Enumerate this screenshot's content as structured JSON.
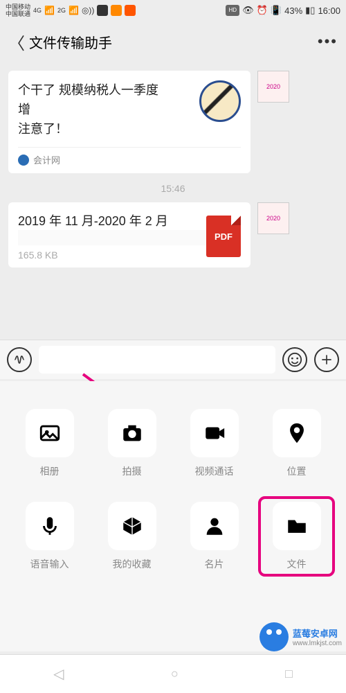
{
  "status": {
    "carrier1": "中国移动",
    "carrier2": "中国联通",
    "net1": "4G",
    "net2": "2G",
    "hd": "HD",
    "battery": "43%",
    "time": "16:00"
  },
  "header": {
    "title": "文件传输助手"
  },
  "article": {
    "line1": "个干了              规模纳税人一季度",
    "line2": "增                                        ",
    "line3": "注意了！",
    "source": "会计网",
    "avatar_badge": "2020"
  },
  "separator_time": "15:46",
  "file": {
    "name_line1": "2019 年 11 月-2020 年 2 月",
    "name_line2": "",
    "size": "165.8 KB",
    "type": "PDF"
  },
  "panel": {
    "items": [
      {
        "label": "相册",
        "icon": "image"
      },
      {
        "label": "拍摄",
        "icon": "camera"
      },
      {
        "label": "视频通话",
        "icon": "video"
      },
      {
        "label": "位置",
        "icon": "location"
      },
      {
        "label": "语音输入",
        "icon": "mic"
      },
      {
        "label": "我的收藏",
        "icon": "box"
      },
      {
        "label": "名片",
        "icon": "person"
      },
      {
        "label": "文件",
        "icon": "folder"
      }
    ]
  },
  "watermark": {
    "name": "蓝莓安卓网",
    "url": "www.lmkjst.com"
  }
}
